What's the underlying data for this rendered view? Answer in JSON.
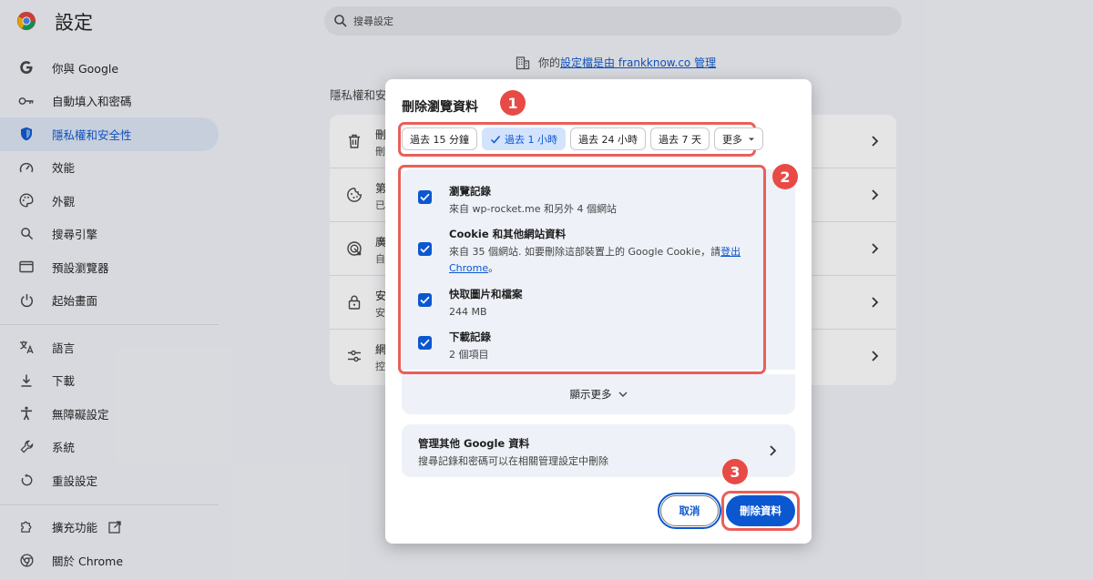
{
  "header": {
    "app_title": "設定",
    "search_placeholder": "搜尋設定"
  },
  "sidebar": {
    "items": [
      {
        "label": "你與 Google",
        "icon": "google-icon"
      },
      {
        "label": "自動填入和密碼",
        "icon": "key-icon"
      },
      {
        "label": "隱私權和安全性",
        "icon": "shield-icon"
      },
      {
        "label": "效能",
        "icon": "speedometer-icon"
      },
      {
        "label": "外觀",
        "icon": "palette-icon"
      },
      {
        "label": "搜尋引擎",
        "icon": "search-icon"
      },
      {
        "label": "預設瀏覽器",
        "icon": "browser-window-icon"
      },
      {
        "label": "起始畫面",
        "icon": "power-icon"
      },
      {
        "label": "語言",
        "icon": "translate-icon"
      },
      {
        "label": "下載",
        "icon": "download-icon"
      },
      {
        "label": "無障礙設定",
        "icon": "accessibility-icon"
      },
      {
        "label": "系統",
        "icon": "wrench-icon"
      },
      {
        "label": "重設設定",
        "icon": "reset-icon"
      },
      {
        "label": "擴充功能",
        "icon": "puzzle-icon"
      },
      {
        "label": "關於 Chrome",
        "icon": "chrome-icon"
      }
    ],
    "active_index": 2
  },
  "main": {
    "managed_prefix": "你的",
    "managed_link": "設定檔是由 frankknow.co 管理",
    "section_title": "隱私權和安",
    "rows": [
      {
        "l1": "刪",
        "l2": "刪",
        "icon": "trash-icon"
      },
      {
        "l1": "第",
        "l2": "已",
        "icon": "cookie-icon"
      },
      {
        "l1": "廣",
        "l2": "自",
        "icon": "ads-icon"
      },
      {
        "l1": "安",
        "l2": "安",
        "icon": "lock-icon"
      },
      {
        "l1": "網",
        "l2": "控",
        "icon": "sliders-icon"
      }
    ]
  },
  "dialog": {
    "title": "刪除瀏覽資料",
    "time_chips": [
      {
        "label": "過去 15 分鐘",
        "selected": false
      },
      {
        "label": "過去 1 小時",
        "selected": true
      },
      {
        "label": "過去 24 小時",
        "selected": false
      },
      {
        "label": "過去 7 天",
        "selected": false
      },
      {
        "label": "更多",
        "selected": false,
        "dropdown": true
      }
    ],
    "options": [
      {
        "title": "瀏覽記錄",
        "subtitle": "來自 wp-rocket.me 和另外 4 個網站",
        "checked": true
      },
      {
        "title": "Cookie 和其他網站資料",
        "subtitle_pre": "來自 35 個網站. 如要刪除這部裝置上的 Google Cookie，請",
        "subtitle_link": "登出 Chrome",
        "subtitle_post": "。",
        "checked": true
      },
      {
        "title": "快取圖片和檔案",
        "subtitle": "244 MB",
        "checked": true
      },
      {
        "title": "下載記錄",
        "subtitle": "2 個項目",
        "checked": true
      }
    ],
    "show_more": "顯示更多",
    "manage": {
      "title": "管理其他 Google 資料",
      "subtitle": "搜尋記錄和密碼可以在相關管理設定中刪除"
    },
    "cancel_label": "取消",
    "delete_label": "刪除資料"
  },
  "annotations": {
    "badges": [
      "1",
      "2",
      "3"
    ],
    "color": "#e84a45"
  },
  "colors": {
    "accent": "#0b57d0",
    "highlight": "#e95f5a"
  }
}
